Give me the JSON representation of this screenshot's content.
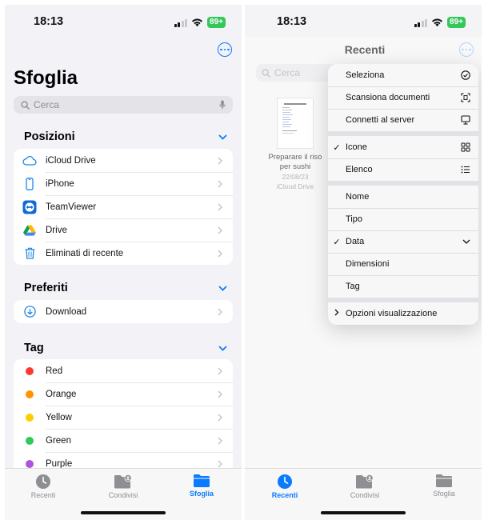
{
  "left": {
    "status": {
      "time": "18:13",
      "battery": "89+"
    },
    "title": "Sfoglia",
    "search_placeholder": "Cerca",
    "positions": {
      "title": "Posizioni",
      "items": [
        {
          "label": "iCloud Drive",
          "icon": "icloud-icon"
        },
        {
          "label": "iPhone",
          "icon": "iphone-icon"
        },
        {
          "label": "TeamViewer",
          "icon": "teamviewer-icon"
        },
        {
          "label": "Drive",
          "icon": "google-drive-icon"
        },
        {
          "label": "Eliminati di recente",
          "icon": "trash-icon"
        }
      ]
    },
    "favorites": {
      "title": "Preferiti",
      "items": [
        {
          "label": "Download",
          "icon": "download-icon"
        }
      ]
    },
    "tags": {
      "title": "Tag",
      "items": [
        {
          "label": "Red",
          "color": "#ff3b30"
        },
        {
          "label": "Orange",
          "color": "#ff9500"
        },
        {
          "label": "Yellow",
          "color": "#ffcc00"
        },
        {
          "label": "Green",
          "color": "#34c759"
        },
        {
          "label": "Purple",
          "color": "#af52de"
        }
      ]
    },
    "tabs": {
      "recent": "Recenti",
      "shared": "Condivisi",
      "browse": "Sfoglia",
      "active": "browse"
    }
  },
  "right": {
    "status": {
      "time": "18:13",
      "battery": "89+"
    },
    "title": "Recenti",
    "search_placeholder": "Cerca",
    "file": {
      "name_line1": "Preparare il riso",
      "name_line2": "per sushi",
      "date": "22/08/23",
      "location": "iCloud Drive"
    },
    "menu": {
      "group1": [
        "Seleziona",
        "Scansiona documenti",
        "Connetti al server"
      ],
      "group2": [
        "Icone",
        "Elenco"
      ],
      "group3": [
        "Nome",
        "Tipo",
        "Data",
        "Dimensioni",
        "Tag"
      ],
      "group4": [
        "Opzioni visualizzazione"
      ]
    },
    "tabs": {
      "recent": "Recenti",
      "shared": "Condivisi",
      "browse": "Sfoglia",
      "active": "recent"
    }
  },
  "colors": {
    "accent": "#0a7aff",
    "background": "#f2f2f7",
    "battery": "#34c759"
  }
}
